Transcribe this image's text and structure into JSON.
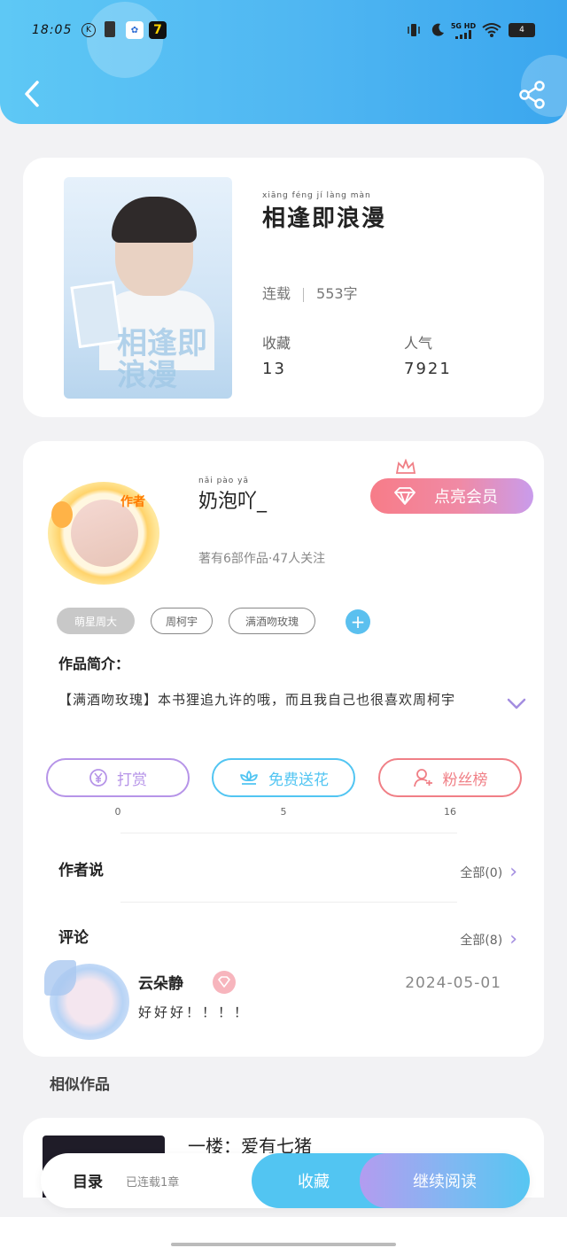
{
  "status_bar": {
    "time": "18:05",
    "network": "5G HD",
    "battery": "4"
  },
  "book": {
    "title": "相逢即浪漫",
    "title_pinyin": "xiāng féng jí làng màn",
    "status": "连载",
    "word_count": "553字",
    "collect_label": "收藏",
    "collect_value": "13",
    "popularity_label": "人气",
    "popularity_value": "7921",
    "cover_text": "相逢即浪漫"
  },
  "author": {
    "name": "奶泡吖_",
    "name_pinyin": "nǎi pào yā",
    "avatar_tag": "作者",
    "summary": "著有6部作品·47人关注",
    "vip_button": "点亮会员",
    "tags": [
      "萌星周大",
      "周柯宇",
      "满酒吻玫瑰"
    ],
    "intro_heading": "作品简介：",
    "intro_text": "【满酒吻玫瑰】本书狸追九许的哦，而且我自己也很喜欢周柯宇",
    "actions": [
      {
        "label": "打赏",
        "count": "0",
        "color": "#b694e8"
      },
      {
        "label": "免费送花",
        "count": "5",
        "color": "#52c5f2"
      },
      {
        "label": "粉丝榜",
        "count": "16",
        "color": "#f07f86"
      }
    ],
    "author_says": "作者说",
    "author_says_all": "全部(0)",
    "comments_heading": "评论",
    "comments_all": "全部(8)"
  },
  "comment": {
    "user": "云朵静",
    "date": "2024-05-01",
    "text": "好好好！！！！"
  },
  "similar": {
    "heading": "相似作品",
    "first_title": "一楼：爱有七猪"
  },
  "bottom_bar": {
    "catalog": "目录",
    "progress": "已连载1章",
    "collect": "收藏",
    "continue": "继续阅读"
  }
}
